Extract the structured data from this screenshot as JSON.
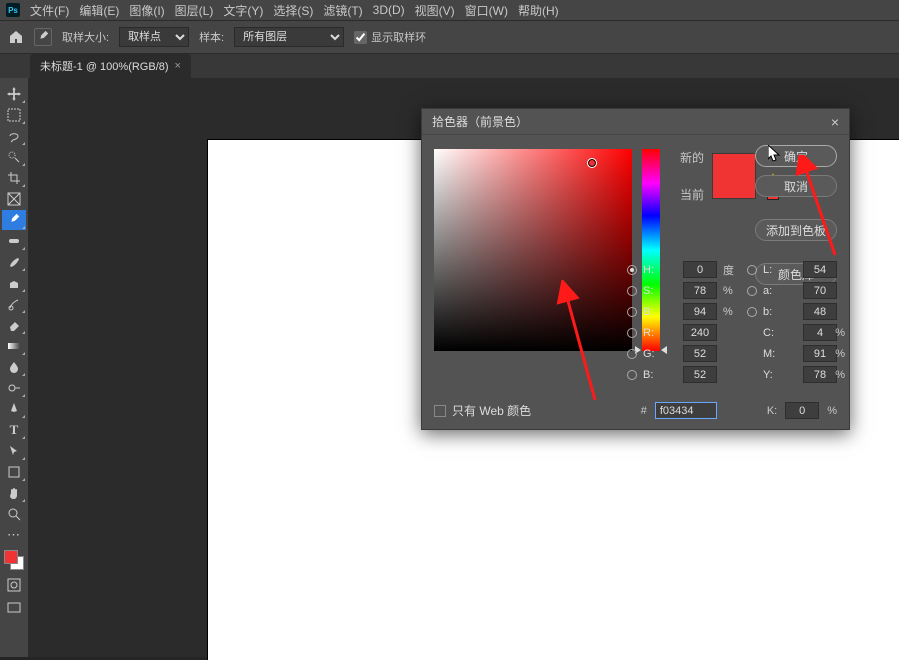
{
  "menu": {
    "items": [
      "文件(F)",
      "编辑(E)",
      "图像(I)",
      "图层(L)",
      "文字(Y)",
      "选择(S)",
      "滤镜(T)",
      "3D(D)",
      "视图(V)",
      "窗口(W)",
      "帮助(H)"
    ]
  },
  "optbar": {
    "sample_size_label": "取样大小:",
    "sample_size_value": "取样点",
    "sample_label": "样本:",
    "sample_value": "所有图层",
    "show_ring_label": "显示取样环",
    "show_ring_checked": true
  },
  "tab": {
    "title": "未标题-1 @ 100%(RGB/8)"
  },
  "swatch": {
    "fg": "#f03434",
    "bg": "#ffffff"
  },
  "dialog": {
    "title": "拾色器（前景色）",
    "new_label": "新的",
    "current_label": "当前",
    "new_color": "#f03434",
    "current_color": "#f03434",
    "btn_ok": "确定",
    "btn_cancel": "取消",
    "btn_add": "添加到色板",
    "btn_lib": "颜色库",
    "web_only_label": "只有 Web 颜色",
    "hex_label": "#",
    "hex_value": "f03434",
    "fields": {
      "H": "0",
      "H_unit": "度",
      "S": "78",
      "S_unit": "%",
      "Bv": "94",
      "Bv_unit": "%",
      "L": "54",
      "a": "70",
      "b_lab": "48",
      "R": "240",
      "G": "52",
      "Bc": "52",
      "C": "4",
      "C_unit": "%",
      "M": "91",
      "M_unit": "%",
      "Y": "78",
      "Y_unit": "%",
      "K": "0",
      "K_unit": "%"
    }
  }
}
